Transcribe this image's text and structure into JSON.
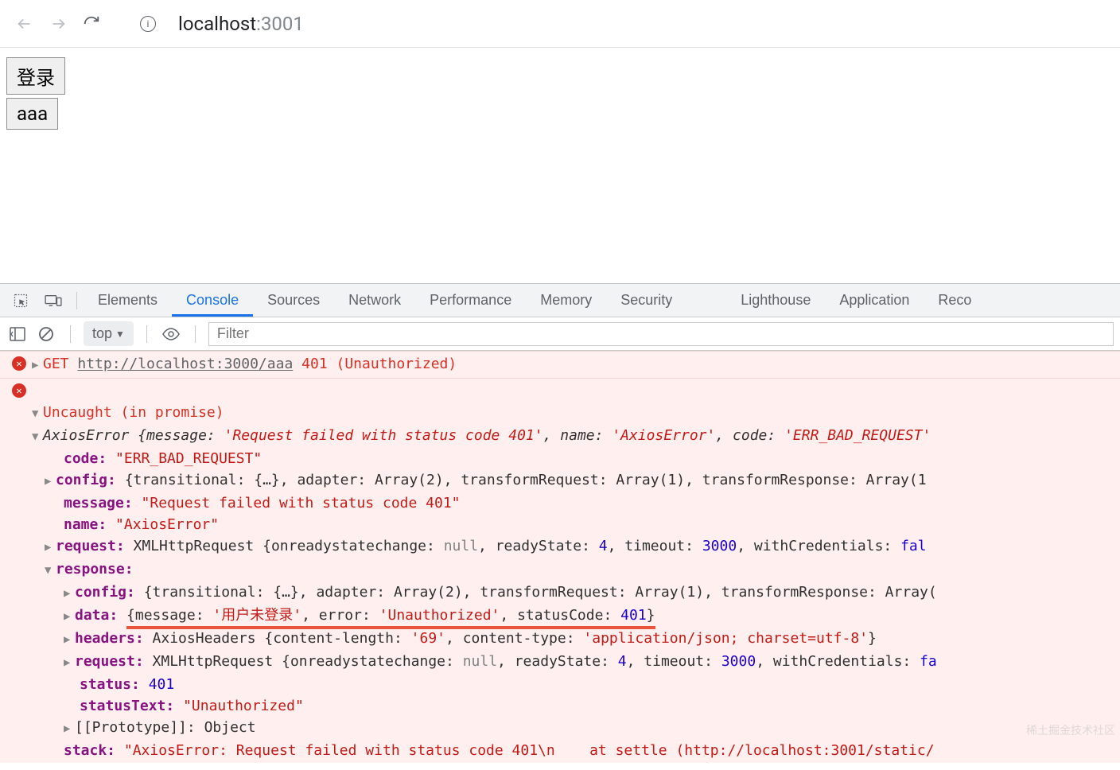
{
  "browser": {
    "url_host": "localhost",
    "url_port": ":3001"
  },
  "page": {
    "btn_login": "登录",
    "btn_aaa": "aaa"
  },
  "devtools": {
    "tabs": {
      "elements": "Elements",
      "console": "Console",
      "sources": "Sources",
      "network": "Network",
      "performance": "Performance",
      "memory": "Memory",
      "security": "Security",
      "lighthouse": "Lighthouse",
      "application": "Application",
      "recorder": "Reco"
    },
    "context": "top",
    "filter_placeholder": "Filter"
  },
  "console": {
    "line1": {
      "method": "GET",
      "url": "http://localhost:3000/aaa",
      "status": "401 (Unauthorized)"
    },
    "line2": "Uncaught (in promise)",
    "axios_summary": {
      "prefix": "AxiosError ",
      "message_k": "message:",
      "message_v": "'Request failed with status code 401'",
      "name_k": "name:",
      "name_v": "'AxiosError'",
      "code_k": "code:",
      "code_v": "'ERR_BAD_REQUEST'"
    },
    "p_code_k": "code:",
    "p_code_v": "\"ERR_BAD_REQUEST\"",
    "p_config_k": "config:",
    "p_config_v": "{transitional: {…}, adapter: Array(2), transformRequest: Array(1), transformResponse: Array(1",
    "p_message_k": "message:",
    "p_message_v": "\"Request failed with status code 401\"",
    "p_name_k": "name:",
    "p_name_v": "\"AxiosError\"",
    "p_request_k": "request:",
    "p_request_v1": "XMLHttpRequest {onreadystatechange: ",
    "p_request_null": "null",
    "p_request_v2": ", readyState: ",
    "p_request_rs": "4",
    "p_request_v3": ", timeout: ",
    "p_request_to": "3000",
    "p_request_v4": ", withCredentials: ",
    "p_request_wc": "fal",
    "p_response_k": "response:",
    "r_config_k": "config:",
    "r_config_v": "{transitional: {…}, adapter: Array(2), transformRequest: Array(1), transformResponse: Array(",
    "r_data_k": "data:",
    "r_data_msg_k": "message:",
    "r_data_msg_v": "'用户未登录'",
    "r_data_err_k": "error:",
    "r_data_err_v": "'Unauthorized'",
    "r_data_sc_k": "statusCode:",
    "r_data_sc_v": "401",
    "r_headers_k": "headers:",
    "r_headers_v1": "AxiosHeaders {content-length: ",
    "r_headers_cl": "'69'",
    "r_headers_v2": ", content-type: ",
    "r_headers_ct": "'application/json; charset=utf-8'",
    "r_headers_v3": "}",
    "r_request_k": "request:",
    "r_request_v1": "XMLHttpRequest {onreadystatechange: ",
    "r_request_null": "null",
    "r_request_v2": ", readyState: ",
    "r_request_rs": "4",
    "r_request_v3": ", timeout: ",
    "r_request_to": "3000",
    "r_request_v4": ", withCredentials: ",
    "r_request_wc": "fa",
    "r_status_k": "status:",
    "r_status_v": "401",
    "r_statustext_k": "statusText:",
    "r_statustext_v": "\"Unauthorized\"",
    "r_proto_k": "[[Prototype]]:",
    "r_proto_v": "Object",
    "p_stack_k": "stack:",
    "p_stack_v": "\"AxiosError: Request failed with status code 401\\n    at settle (http://localhost:3001/static/"
  },
  "watermark": "稀土掘金技术社区"
}
